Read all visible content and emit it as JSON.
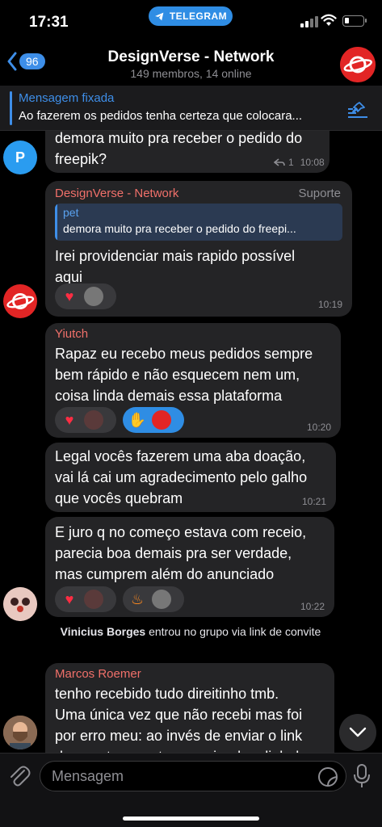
{
  "status_bar": {
    "time": "17:31",
    "app_pill": "TELEGRAM"
  },
  "header": {
    "back_badge": "96",
    "title": "DesignVerse - Network",
    "subtitle": "149 membros, 14 online"
  },
  "pinned": {
    "label": "Mensagem fixada",
    "text": "Ao fazerem os pedidos tenha certeza que colocara..."
  },
  "messages": [
    {
      "avatar_letter": "P",
      "text": "demora muito pra receber o pedido do\nfreepik?",
      "replies": "1",
      "time": "10:08"
    },
    {
      "sender": "DesignVerse - Network",
      "tag": "Suporte",
      "reply_name": "pet",
      "reply_text": "demora muito pra receber o pedido do freepi...",
      "text": "Irei providenciar mais rapido possível\naqui",
      "time": "10:19"
    },
    {
      "sender": "Yiutch",
      "text": "Rapaz eu recebo meus pedidos sempre\nbem rápido e não esquecem nem um,\ncoisa linda demais essa plataforma",
      "time": "10:20"
    },
    {
      "text": "Legal vocês fazerem uma aba doação,\nvai lá cai um agradecimento pelo galho\nque vocês quebram",
      "time": "10:21"
    },
    {
      "text": "E juro q no começo estava com receio,\nparecia boa demais pra ser verdade,\nmas cumprem além do anunciado",
      "time": "10:22"
    },
    {
      "sender": "Marcos Roemer",
      "text": "tenho recebido tudo direitinho tmb.\nUma única vez que não recebi mas foi\npor erro meu: ao invés de enviar o link\nda envato eu estava enviando o link da"
    }
  ],
  "system_message": {
    "name": "Vinicius Borges",
    "text": " entrou no grupo via link de convite"
  },
  "input": {
    "placeholder": "Mensagem"
  },
  "colors": {
    "accent": "#2f8de4",
    "sender_red": "#f0706a",
    "bubble": "#242426",
    "brand_red": "#e22525"
  },
  "icons": [
    "telegram-icon",
    "back-chevron-icon",
    "pin-list-icon",
    "reply-arrow-icon",
    "heart-icon",
    "fire-icon",
    "clap-icon",
    "chevron-down-icon",
    "paperclip-icon",
    "sticker-icon",
    "microphone-icon"
  ]
}
